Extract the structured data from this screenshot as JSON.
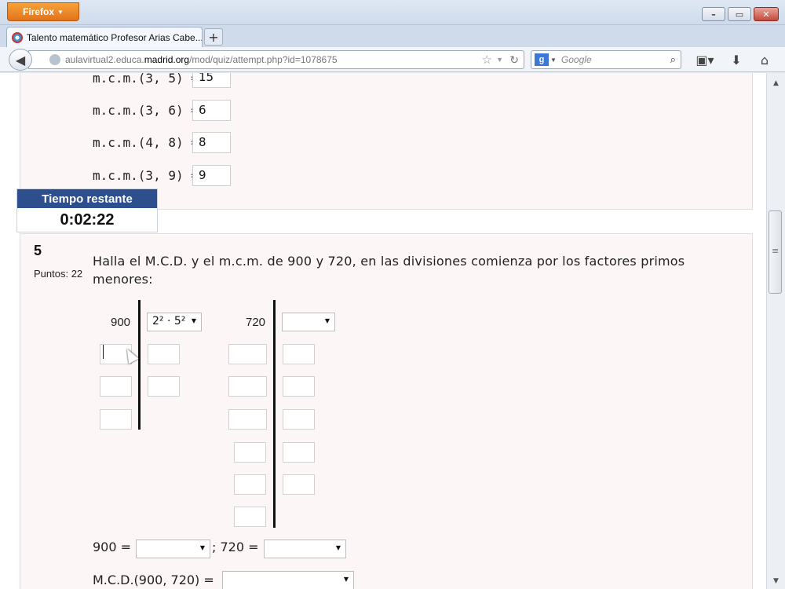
{
  "browser": {
    "menu_button": "Firefox",
    "tab_title": "Talento matemático Profesor Arias Cabe...",
    "new_tab": "+",
    "url_prefix": "aulavirtual2.educa.",
    "url_domain": "madrid.org",
    "url_path": "/mod/quiz/attempt.php?id=1078675",
    "search_placeholder": "Google",
    "window_controls": [
      "minimize",
      "maximize",
      "close"
    ]
  },
  "question4": {
    "rows": [
      {
        "label": "m.c.m.(3, 5) =",
        "answer": "15"
      },
      {
        "label": "m.c.m.(3, 6) =",
        "answer": "6"
      },
      {
        "label": "m.c.m.(4, 8) =",
        "answer": "8"
      },
      {
        "label": "m.c.m.(3, 9) =",
        "answer": "9"
      }
    ]
  },
  "timer": {
    "title": "Tiempo restante",
    "value": "0:02:22"
  },
  "question5": {
    "number": "5",
    "points": "Puntos: 22",
    "text": "Halla el M.C.D. y el m.c.m. de 900 y 720, en las divisiones comienza por los factores primos menores:",
    "left_number": "900",
    "left_select": "2² · 5²",
    "right_number": "720",
    "right_select": "",
    "factor_line_a": "900 =",
    "factor_line_sep": "; 720 =",
    "mcd_line": "M.C.D.(900, 720) ="
  }
}
